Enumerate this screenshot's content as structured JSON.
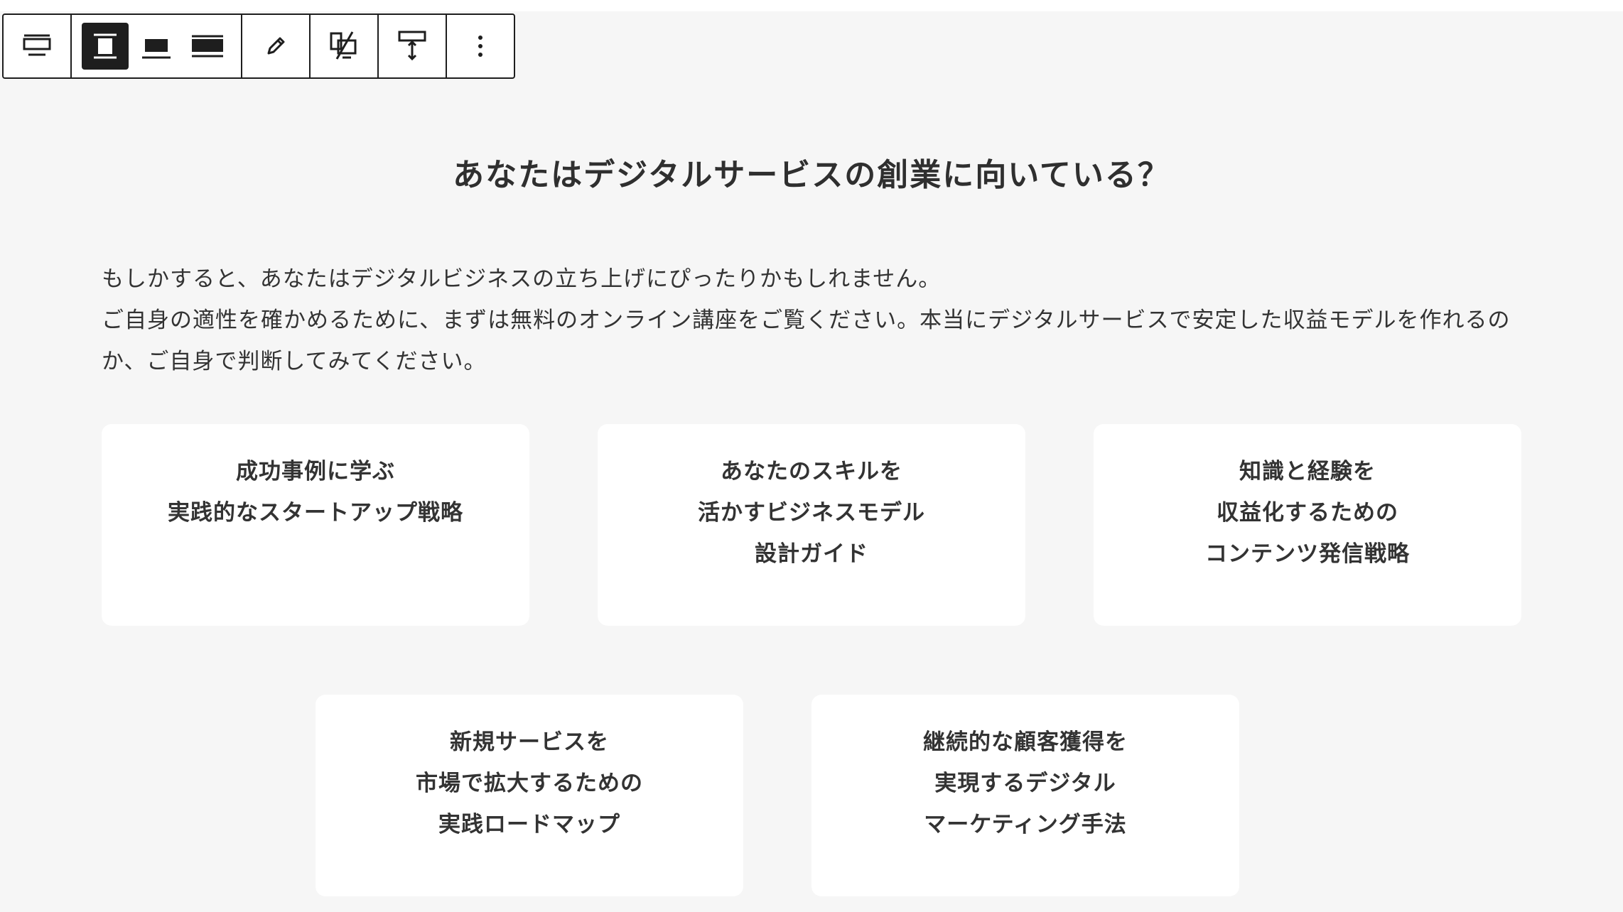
{
  "toolbar": {
    "buttons": [
      {
        "icon": "block-type-icon"
      },
      {
        "icon": "align-top-icon"
      },
      {
        "icon": "align-middle-icon"
      },
      {
        "icon": "align-bottom-icon"
      },
      {
        "icon": "edit-pencil-icon"
      },
      {
        "icon": "toggle-display-icon"
      },
      {
        "icon": "height-adjust-icon"
      },
      {
        "icon": "more-options-icon"
      }
    ],
    "active_color": "#1e1e1e"
  },
  "section": {
    "title": "あなたはデジタルサービスの創業に向いている？",
    "intro_line1": "もしかすると、あなたはデジタルビジネスの立ち上げにぴったりかもしれません。",
    "intro_line2": "ご自身の適性を確かめるために、まずは無料のオンライン講座をご覧ください。本当にデジタルサービスで安定した収益モデルを作れるの",
    "intro_line3": "か、ご自身で判断してみてください。"
  },
  "cards": [
    {
      "lines": [
        "成功事例に学ぶ",
        "実践的なスタートアップ戦略"
      ]
    },
    {
      "lines": [
        "あなたのスキルを",
        "活かすビジネスモデル",
        "設計ガイド"
      ]
    },
    {
      "lines": [
        "知識と経験を",
        "収益化するための",
        "コンテンツ発信戦略"
      ]
    },
    {
      "lines": [
        "新規サービスを",
        "市場で拡大するための",
        "実践ロードマップ"
      ]
    },
    {
      "lines": [
        "継続的な顧客獲得を",
        "実現するデジタル",
        "マーケティング手法"
      ]
    }
  ],
  "colors": {
    "background": "#f6f6f6",
    "card": "#ffffff",
    "text": "#333333"
  }
}
